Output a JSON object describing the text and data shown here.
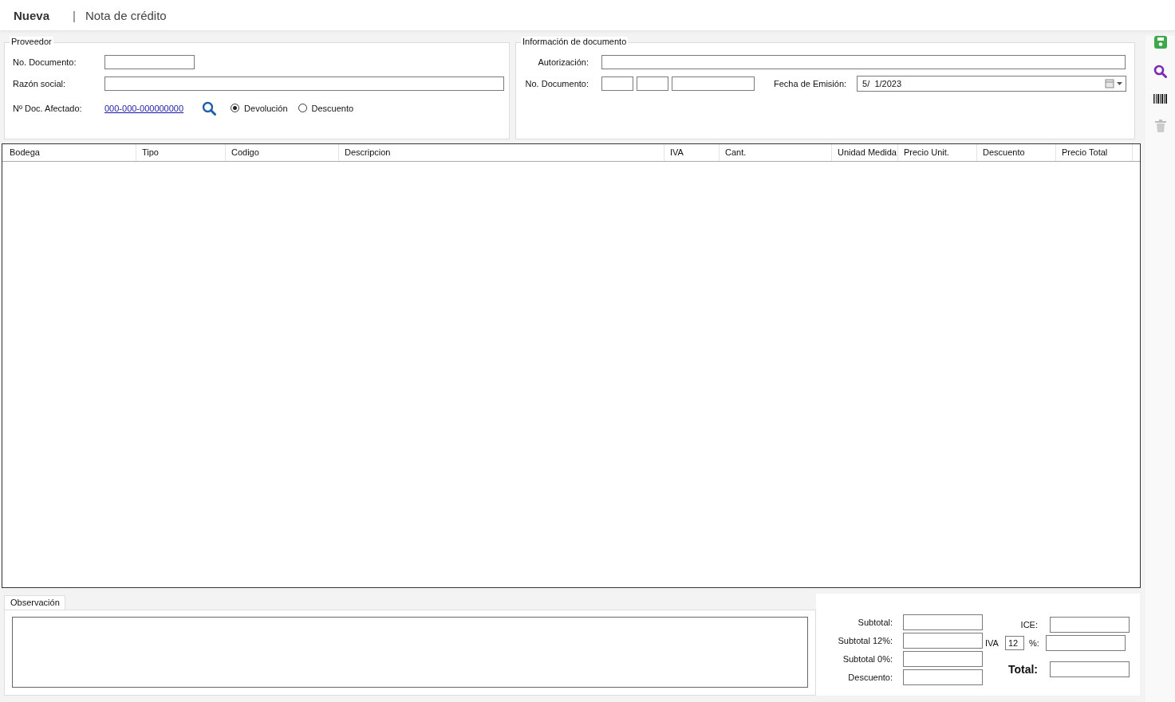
{
  "header": {
    "title": "Nueva",
    "separator": "|",
    "subtitle": "Nota de crédito"
  },
  "proveedor": {
    "legend": "Proveedor",
    "fields": [
      {
        "label": "No. Documento:",
        "kind": "short"
      },
      {
        "label": "Razón social:",
        "kind": "long"
      }
    ],
    "affected": {
      "label": "Nº Doc. Afectado:",
      "link": "000-000-000000000"
    },
    "radios": [
      {
        "label": "Devolución",
        "selected": true
      },
      {
        "label": "Descuento",
        "selected": false
      }
    ]
  },
  "documento": {
    "legend": "Información de documento",
    "autorizacion_label": "Autorización:",
    "numero_label": "No. Documento:",
    "fecha_label": "Fecha de Emisión:",
    "fecha_value": "5/  1/2023"
  },
  "table": {
    "columns": [
      "Bodega",
      "Tipo",
      "Codigo",
      "Descripcion",
      "IVA",
      "Cant.",
      "Unidad Medida",
      "Precio Unit.",
      "Descuento",
      "Precio Total"
    ]
  },
  "observacion": {
    "tab": "Observación"
  },
  "totals": {
    "left": [
      "Subtotal:",
      "Subtotal 12%:",
      "Subtotal 0%:",
      "Descuento:"
    ],
    "ice_label": "ICE:",
    "iva_label": "IVA",
    "iva_rate": "12",
    "percent_label": "%:",
    "total_label": "Total:"
  }
}
